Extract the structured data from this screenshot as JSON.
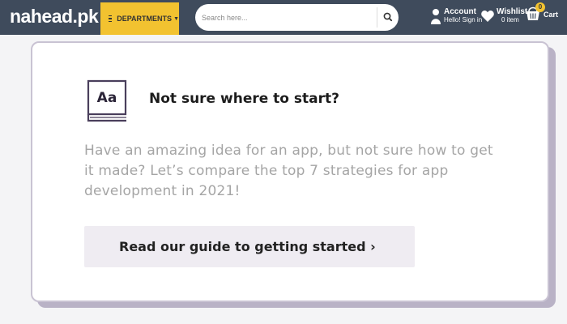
{
  "header": {
    "logo": {
      "before": "nahe",
      "mid": "a",
      "after": "d.pk"
    },
    "departments_label": "DEPARTMENTS",
    "search_placeholder": "Search here...",
    "account": {
      "title": "Account",
      "subtitle": "Hello! Sign in"
    },
    "wishlist": {
      "title": "Wishlist",
      "subtitle": "0 item"
    },
    "cart": {
      "label": "Cart",
      "count": "0"
    },
    "colors": {
      "bar": "#3f4b5c",
      "accent": "#f2c230"
    }
  },
  "card": {
    "icon_text": "Aa",
    "title": "Not sure where to start?",
    "description": "Have an amazing idea for an app, but not sure how to get it made? Let’s compare the top 7 strategies for app development in 2021!",
    "button_label": "Read our guide to getting started ›"
  }
}
